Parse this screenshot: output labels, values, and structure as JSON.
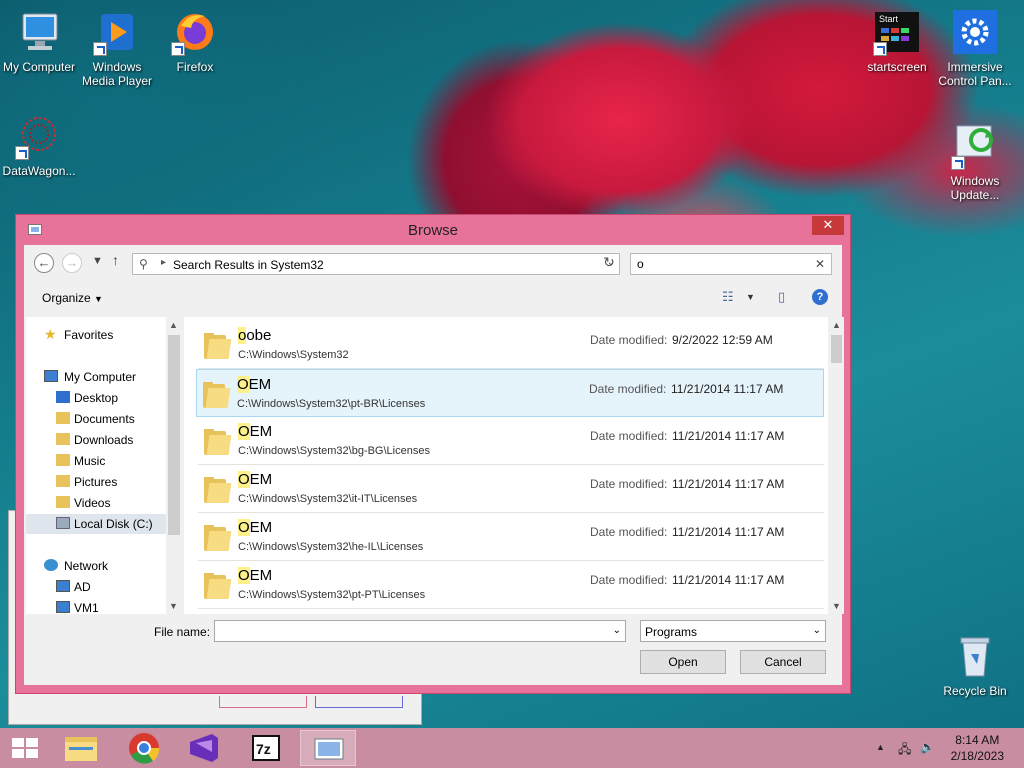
{
  "desktop": {
    "icons": [
      {
        "label": "My Computer"
      },
      {
        "label": "Windows Media Player"
      },
      {
        "label": "Firefox"
      },
      {
        "label": "DataWagon..."
      },
      {
        "label": "startscreen",
        "tile_text": "Start"
      },
      {
        "label": "Immersive Control Pan..."
      },
      {
        "label": "Windows Update..."
      },
      {
        "label": "Recycle Bin"
      }
    ]
  },
  "dialog": {
    "title": "Browse",
    "close_label": "✕",
    "address": {
      "crumb": "Search Results in System32"
    },
    "search": {
      "value": "o"
    },
    "toolbar": {
      "organize_label": "Organize"
    },
    "nav": {
      "favorites": "Favorites",
      "my_computer": "My Computer",
      "desktop": "Desktop",
      "documents": "Documents",
      "downloads": "Downloads",
      "music": "Music",
      "pictures": "Pictures",
      "videos": "Videos",
      "local_disk": "Local Disk (C:)",
      "network": "Network",
      "ad": "AD",
      "vm1": "VM1"
    },
    "date_modified_label": "Date modified:",
    "results": [
      {
        "name_hl": "o",
        "name_rest": "obe",
        "path": "C:\\Windows\\System32",
        "date": "9/2/2022 12:59 AM"
      },
      {
        "name_hl": "O",
        "name_rest": "EM",
        "path": "C:\\Windows\\System32\\pt-BR\\Licenses",
        "date": "11/21/2014 11:17 AM"
      },
      {
        "name_hl": "O",
        "name_rest": "EM",
        "path": "C:\\Windows\\System32\\bg-BG\\Licenses",
        "date": "11/21/2014 11:17 AM"
      },
      {
        "name_hl": "O",
        "name_rest": "EM",
        "path": "C:\\Windows\\System32\\it-IT\\Licenses",
        "date": "11/21/2014 11:17 AM"
      },
      {
        "name_hl": "O",
        "name_rest": "EM",
        "path": "C:\\Windows\\System32\\he-IL\\Licenses",
        "date": "11/21/2014 11:17 AM"
      },
      {
        "name_hl": "O",
        "name_rest": "EM",
        "path": "C:\\Windows\\System32\\pt-PT\\Licenses",
        "date": "11/21/2014 11:17 AM"
      }
    ],
    "file_name_label": "File name:",
    "file_name_value": "",
    "file_type": "Programs",
    "open_label": "Open",
    "cancel_label": "Cancel"
  },
  "taskbar": {
    "time": "8:14 AM",
    "date": "2/18/2023"
  },
  "colors": {
    "dialog_frame": "#e8739a",
    "close_button": "#c7383a",
    "taskbar": "#c98da1",
    "selection": "#e5f3fb",
    "match_highlight": "#fef08a"
  }
}
